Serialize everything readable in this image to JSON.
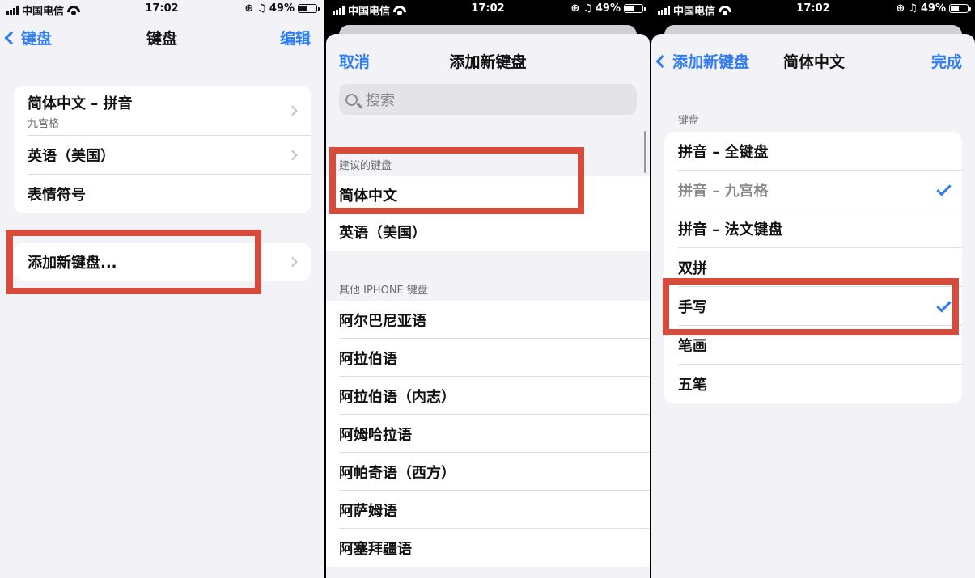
{
  "status": {
    "carrier": "中国电信",
    "time": "17:02",
    "battery": "49%"
  },
  "screen1": {
    "back_label": "键盘",
    "title": "键盘",
    "action": "编辑",
    "keyboards": [
      {
        "label": "简体中文 – 拼音",
        "sublabel": "九宫格"
      },
      {
        "label": "英语（美国）"
      },
      {
        "label": "表情符号"
      }
    ],
    "add_label": "添加新键盘..."
  },
  "screen2": {
    "cancel_label": "取消",
    "title": "添加新键盘",
    "search_placeholder": "搜索",
    "suggested_header": "建议的键盘",
    "suggested": [
      "简体中文",
      "英语（美国）"
    ],
    "other_header": "其他 IPHONE 键盘",
    "others": [
      "阿尔巴尼亚语",
      "阿拉伯语",
      "阿拉伯语（内志）",
      "阿姆哈拉语",
      "阿帕奇语（西方）",
      "阿萨姆语",
      "阿塞拜疆语"
    ]
  },
  "screen3": {
    "back_label": "添加新键盘",
    "title": "简体中文",
    "done_label": "完成",
    "section_header": "键盘",
    "options": [
      {
        "label": "拼音 – 全键盘",
        "checked": false
      },
      {
        "label": "拼音 – 九宫格",
        "checked": true,
        "disabled": true
      },
      {
        "label": "拼音 – 法文键盘",
        "checked": false
      },
      {
        "label": "双拼",
        "checked": false
      },
      {
        "label": "手写",
        "checked": true
      },
      {
        "label": "笔画",
        "checked": false
      },
      {
        "label": "五笔",
        "checked": false
      }
    ]
  },
  "colors": {
    "accent": "#2f7cf6",
    "highlight": "#d84a3a",
    "background": "#f2f2f7"
  }
}
